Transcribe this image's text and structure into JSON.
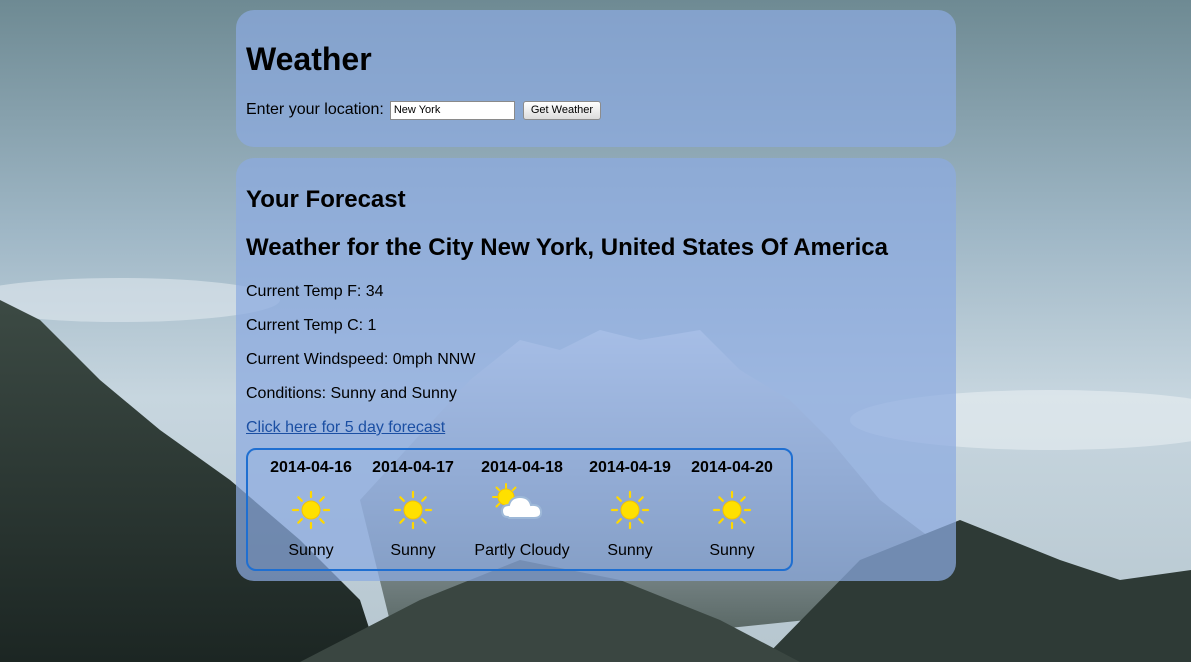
{
  "header": {
    "title": "Weather",
    "location_label": "Enter your location:",
    "location_value": "New York",
    "get_weather_label": "Get Weather"
  },
  "forecast": {
    "heading": "Your Forecast",
    "city_heading": "Weather for the City New York, United States Of America",
    "temp_f": "Current Temp F: 34",
    "temp_c": "Current Temp C: 1",
    "windspeed": "Current Windspeed: 0mph NNW",
    "conditions": "Conditions: Sunny and Sunny",
    "five_day_link": "Click here for 5 day forecast",
    "days": [
      {
        "date": "2014-04-16",
        "condition": "Sunny",
        "icon": "sun-icon"
      },
      {
        "date": "2014-04-17",
        "condition": "Sunny",
        "icon": "sun-icon"
      },
      {
        "date": "2014-04-18",
        "condition": "Partly Cloudy",
        "icon": "partly-cloudy-icon"
      },
      {
        "date": "2014-04-19",
        "condition": "Sunny",
        "icon": "sun-icon"
      },
      {
        "date": "2014-04-20",
        "condition": "Sunny",
        "icon": "sun-icon"
      }
    ]
  },
  "colors": {
    "panel": "#8caae1",
    "border_accent": "#1f6fd1",
    "link": "#1b4fa3",
    "sun": "#ffe000"
  }
}
